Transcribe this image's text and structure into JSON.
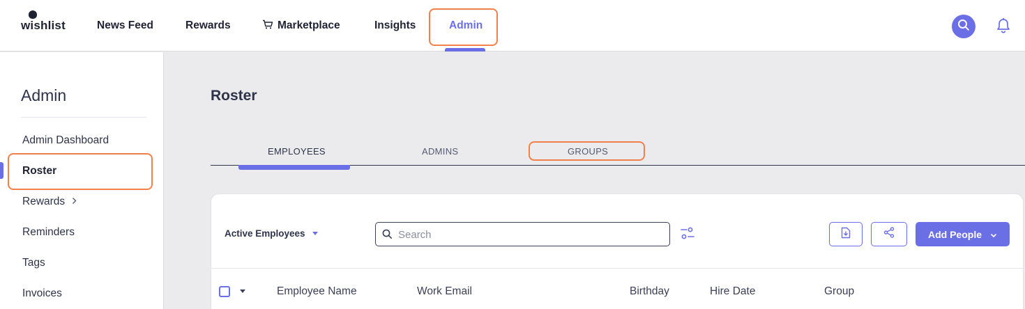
{
  "app": {
    "logo": "wishlist"
  },
  "nav": {
    "items": [
      {
        "label": "News Feed"
      },
      {
        "label": "Rewards"
      },
      {
        "label": "Marketplace",
        "icon": "cart-icon"
      },
      {
        "label": "Insights"
      },
      {
        "label": "Admin",
        "active": true
      }
    ],
    "search_icon": "search-icon",
    "bell_icon": "bell-icon"
  },
  "sidebar": {
    "title": "Admin",
    "items": [
      {
        "label": "Admin Dashboard"
      },
      {
        "label": "Roster",
        "active": true
      },
      {
        "label": "Rewards",
        "has_submenu": true
      },
      {
        "label": "Reminders"
      },
      {
        "label": "Tags"
      },
      {
        "label": "Invoices"
      }
    ]
  },
  "main": {
    "title": "Roster",
    "tabs": [
      {
        "label": "EMPLOYEES",
        "active": true
      },
      {
        "label": "ADMINS"
      },
      {
        "label": "GROUPS"
      }
    ],
    "toolbar": {
      "filter_label": "Active Employees",
      "search_placeholder": "Search",
      "add_button_label": "Add People"
    },
    "table": {
      "columns": [
        "Employee Name",
        "Work Email",
        "Birthday",
        "Hire Date",
        "Group"
      ]
    }
  },
  "colors": {
    "accent": "#6b6fe6",
    "highlight": "#f2804a",
    "text": "#2f3349",
    "background": "#ebebed"
  }
}
